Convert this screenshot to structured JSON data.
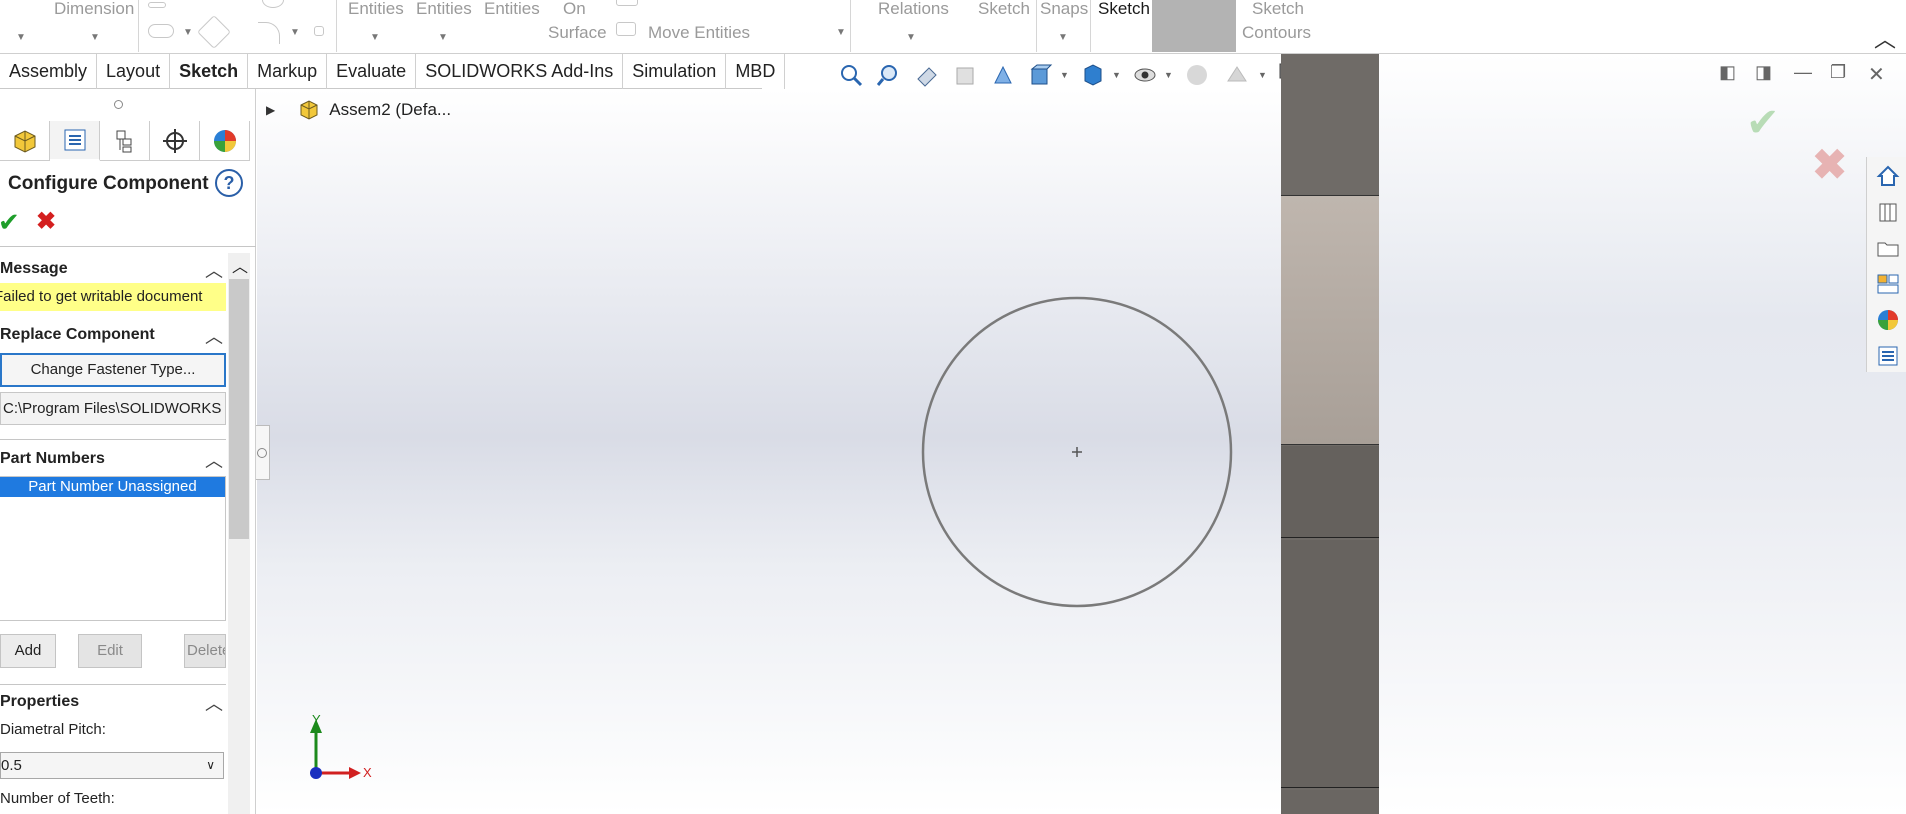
{
  "ribbon": {
    "items": [
      {
        "label": "Dimension"
      },
      {
        "label": "Entities"
      },
      {
        "label": "Entities"
      },
      {
        "label": "Entities"
      },
      {
        "label": "On"
      },
      {
        "label": "Surface"
      },
      {
        "label": "Move Entities"
      },
      {
        "label": "Relations"
      },
      {
        "label": "Sketch"
      },
      {
        "label": "Snaps"
      },
      {
        "label": "Sketch"
      },
      {
        "label": "Sketch"
      },
      {
        "label": "Contours"
      }
    ]
  },
  "tabs": [
    "Assembly",
    "Layout",
    "Sketch",
    "Markup",
    "Evaluate",
    "SOLIDWORKS Add-Ins",
    "Simulation",
    "MBD"
  ],
  "active_tab": "Sketch",
  "tree": {
    "root": "Assem2 (Defa..."
  },
  "panel": {
    "title": "Configure Component",
    "help": "?",
    "message_header": "Message",
    "message_text": "Failed to get writable document",
    "replace_header": "Replace Component",
    "change_fastener_btn": "Change Fastener Type...",
    "path": "C:\\Program Files\\SOLIDWORKS",
    "part_numbers_header": "Part Numbers",
    "part_number_item": "Part Number Unassigned",
    "add_btn": "Add",
    "edit_btn": "Edit",
    "delete_btn": "Delete",
    "properties_header": "Properties",
    "diametral_pitch_label": "Diametral Pitch:",
    "diametral_pitch_value": "0.5",
    "teeth_label": "Number of Teeth:"
  },
  "axis": {
    "x": "X",
    "y": "Y"
  },
  "colors": {
    "accent": "#1f7ae0",
    "message_bg": "#ffff88",
    "ok": "#1e9e2a",
    "cancel": "#d41f1f"
  }
}
